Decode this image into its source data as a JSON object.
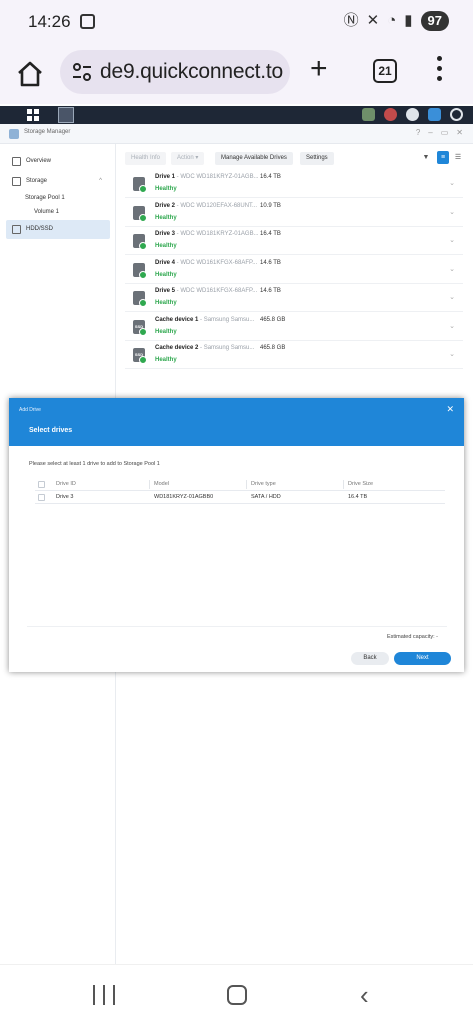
{
  "status_bar": {
    "time": "14:26",
    "battery": "97"
  },
  "browser": {
    "url": "de9.quickconnect.to",
    "tab_count": "21"
  },
  "window": {
    "title": "Storage Manager"
  },
  "sidebar": {
    "overview": "Overview",
    "storage": "Storage",
    "storage_pool": "Storage Pool 1",
    "volume": "Volume 1",
    "hdd_ssd": "HDD/SSD"
  },
  "toolbar": {
    "health_info": "Health Info",
    "action": "Action ▾",
    "manage": "Manage Available Drives",
    "settings": "Settings"
  },
  "drives": [
    {
      "name": "Drive 1",
      "model": " - WDC WD181KRYZ-01AGB...",
      "size": "16.4 TB",
      "status": "Healthy"
    },
    {
      "name": "Drive 2",
      "model": " - WDC WD120EFAX-68UNT...",
      "size": "10.9 TB",
      "status": "Healthy"
    },
    {
      "name": "Drive 3",
      "model": " - WDC WD181KRYZ-01AGB...",
      "size": "16.4 TB",
      "status": "Healthy"
    },
    {
      "name": "Drive 4",
      "model": " - WDC WD161KFGX-68AFP...",
      "size": "14.6 TB",
      "status": "Healthy"
    },
    {
      "name": "Drive 5",
      "model": " - WDC WD161KFGX-68AFP...",
      "size": "14.6 TB",
      "status": "Healthy"
    },
    {
      "name": "Cache device 1",
      "model": " - Samsung Samsu...",
      "size": "465.8 GB",
      "status": "Healthy"
    },
    {
      "name": "Cache device 2",
      "model": " - Samsung Samsu...",
      "size": "465.8 GB",
      "status": "Healthy"
    }
  ],
  "modal": {
    "small_title": "Add Drive",
    "title": "Select drives",
    "prompt": "Please select at least 1 drive to add to Storage Pool 1",
    "columns": [
      "Drive ID",
      "Model",
      "Drive type",
      "Drive Size"
    ],
    "rows": [
      {
        "id": "Drive 3",
        "model": "WD181KRYZ-01AGBB0",
        "type": "SATA / HDD",
        "size": "16.4 TB"
      }
    ],
    "estimated": "Estimated capacity: -",
    "back": "Back",
    "next": "Next"
  },
  "colors": {
    "accent": "#1f86d8",
    "healthy": "#2fa84f",
    "dsm_bar": "#1e2736"
  }
}
